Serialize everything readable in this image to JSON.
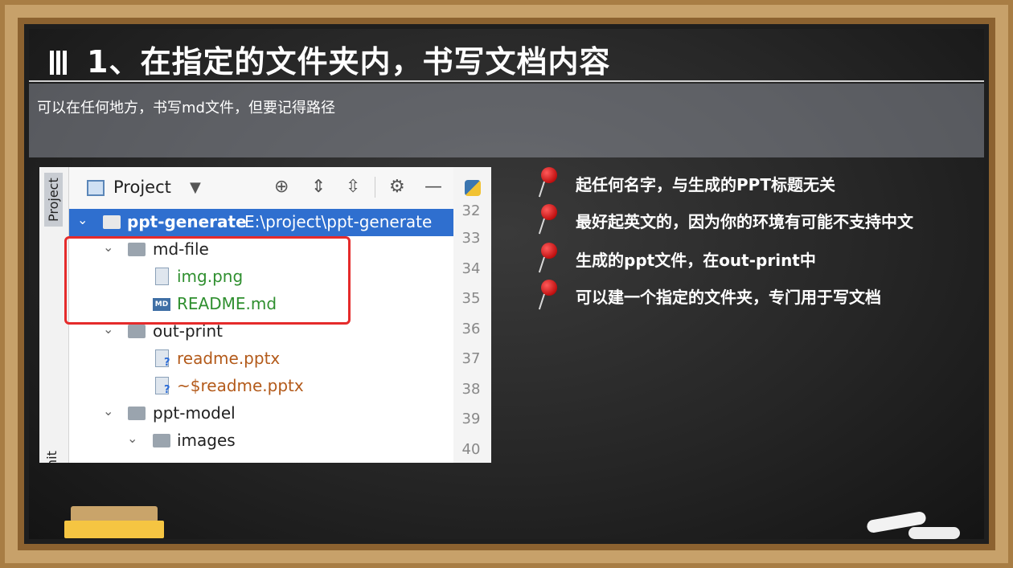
{
  "slide": {
    "title": "1、在指定的文件夹内，书写文档内容",
    "subtitle": "可以在任何地方，书写md文件，但要记得路径"
  },
  "ide": {
    "side_tabs": [
      "Project",
      "Commit"
    ],
    "toolbar": {
      "label": "Project",
      "icons": [
        "locate-icon",
        "expand-all-icon",
        "collapse-all-icon",
        "gear-icon",
        "hide-icon"
      ]
    },
    "tree": [
      {
        "name": "ppt-generate",
        "path": "E:\\project\\ppt-generate",
        "type": "folder",
        "expanded": true,
        "selected": true
      },
      {
        "name": "md-file",
        "type": "folder",
        "expanded": true
      },
      {
        "name": "img.png",
        "type": "image-file"
      },
      {
        "name": "README.md",
        "type": "md-file"
      },
      {
        "name": "out-print",
        "type": "folder",
        "expanded": true
      },
      {
        "name": "readme.pptx",
        "type": "unknown-file"
      },
      {
        "name": "~$readme.pptx",
        "type": "unknown-file"
      },
      {
        "name": "ppt-model",
        "type": "folder",
        "expanded": true
      },
      {
        "name": "images",
        "type": "folder",
        "expanded": true
      }
    ],
    "line_numbers": [
      "32",
      "33",
      "34",
      "35",
      "36",
      "37",
      "38",
      "39",
      "40"
    ]
  },
  "bullets": [
    "起任何名字，与生成的PPT标题无关",
    "最好起英文的，因为你的环境有可能不支持中文",
    "生成的ppt文件，在out-print中",
    "可以建一个指定的文件夹，专门用于写文档"
  ],
  "colors": {
    "frame": "#c7a16a",
    "board": "#262626",
    "highlight_box": "#e52b2b",
    "selection": "#2f6fcf",
    "vcs_added": "#2f8f2f",
    "vcs_unversioned": "#b35a1a",
    "eraser": "#f5c542"
  }
}
